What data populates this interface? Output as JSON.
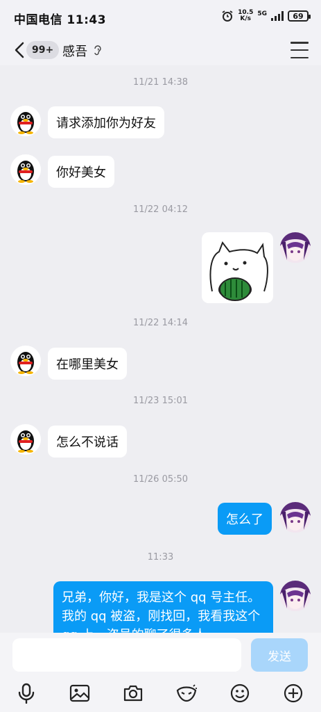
{
  "status": {
    "carrier": "中国电信",
    "time": "11:43",
    "speed_top": "10.5",
    "speed_bottom": "K/s",
    "network": "5G",
    "battery": "69"
  },
  "header": {
    "unread_count": "99+",
    "contact_name": "感吾"
  },
  "messages": {
    "ts1": "11/21 14:38",
    "m1": "请求添加你为好友",
    "m2": "你好美女",
    "ts2": "11/22 04:12",
    "ts3": "11/22 14:14",
    "m3": "在哪里美女",
    "ts4": "11/23 15:01",
    "m4": "怎么不说话",
    "ts5": "11/26 05:50",
    "m5": "怎么了",
    "ts6": "11:33",
    "m6": "兄弟，你好，我是这个 qq 号主任。我的 qq 被盗，刚找回，我看我这个 qq 上，盗号的聊了很多人"
  },
  "composer": {
    "send_label": "发送"
  },
  "colors": {
    "bubble_out": "#0a9bf6",
    "send_disabled": "#a9d6fb"
  }
}
